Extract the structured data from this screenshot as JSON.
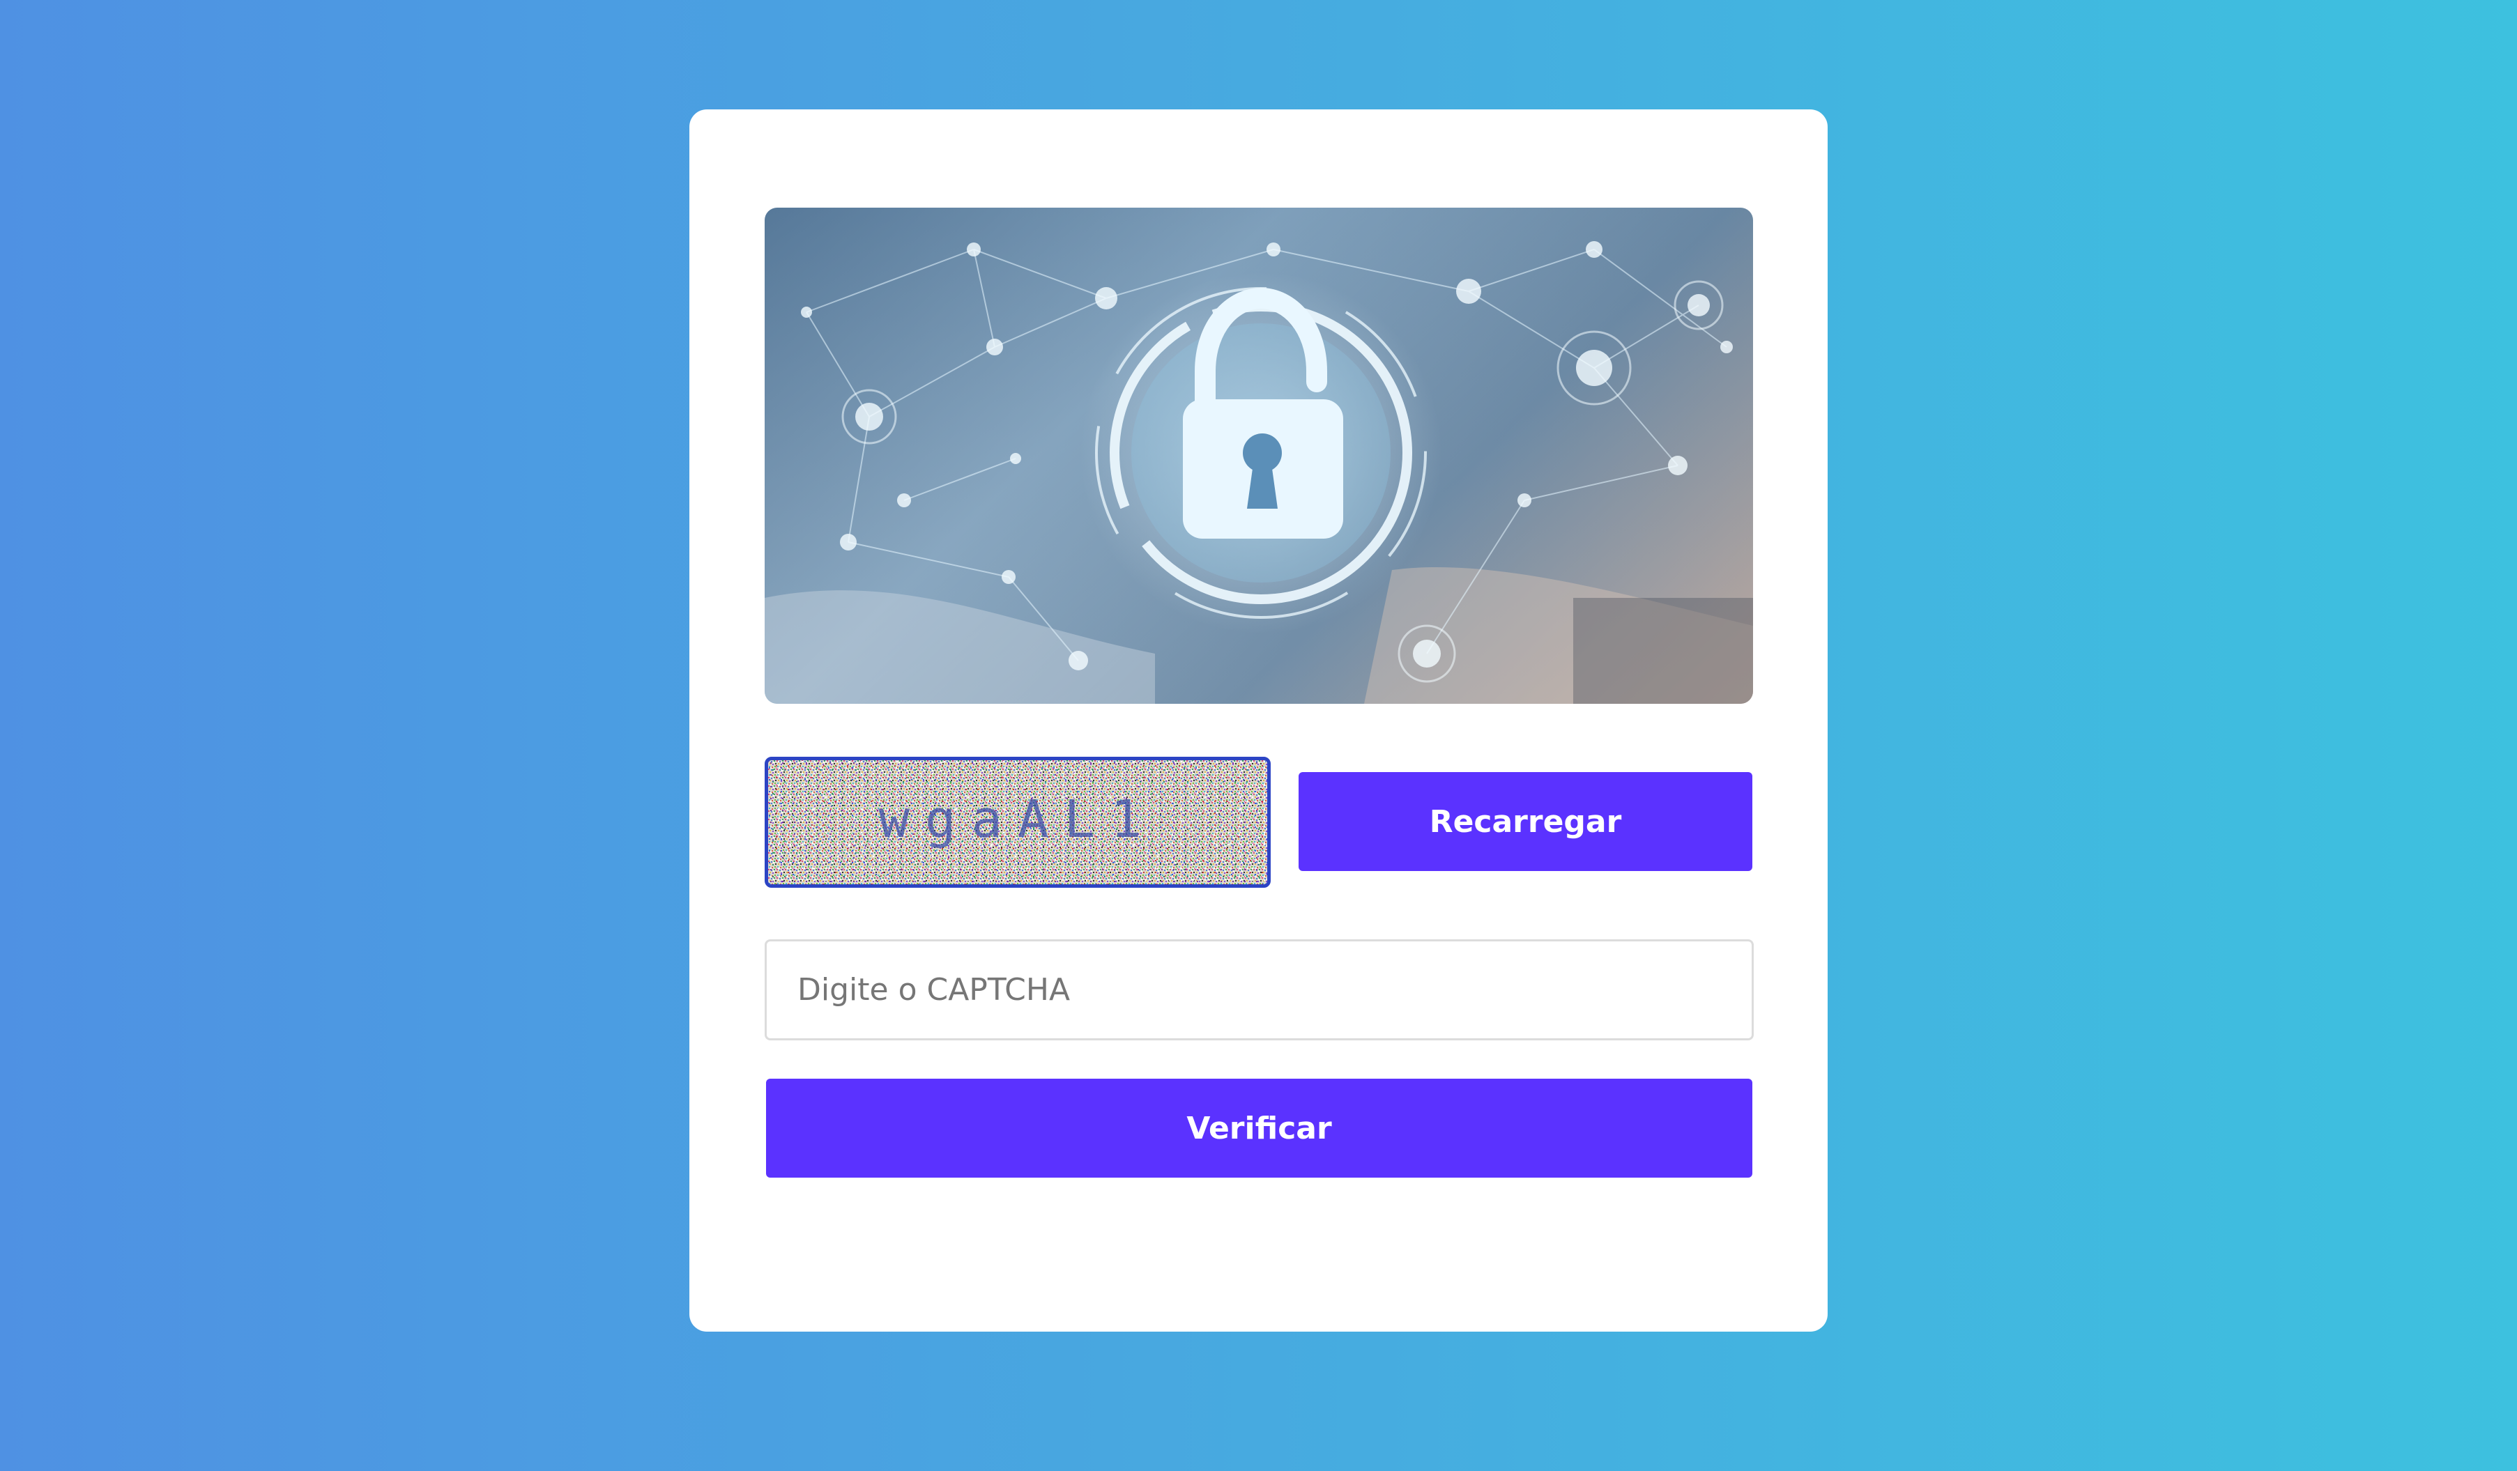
{
  "hero": {
    "icon": "unlocked-padlock-icon",
    "alt": "cyber security padlock illustration"
  },
  "captcha": {
    "text": "wgaAL1",
    "colors": {
      "border": "#2c44c4",
      "text": "#3a4ea8"
    }
  },
  "buttons": {
    "reload_label": "Recarregar",
    "verify_label": "Verificar"
  },
  "input": {
    "placeholder": "Digite o CAPTCHA",
    "value": ""
  },
  "colors": {
    "accent": "#5b32ff",
    "background_start": "#4f91e3",
    "background_end": "#3dc1df",
    "card": "#ffffff"
  }
}
